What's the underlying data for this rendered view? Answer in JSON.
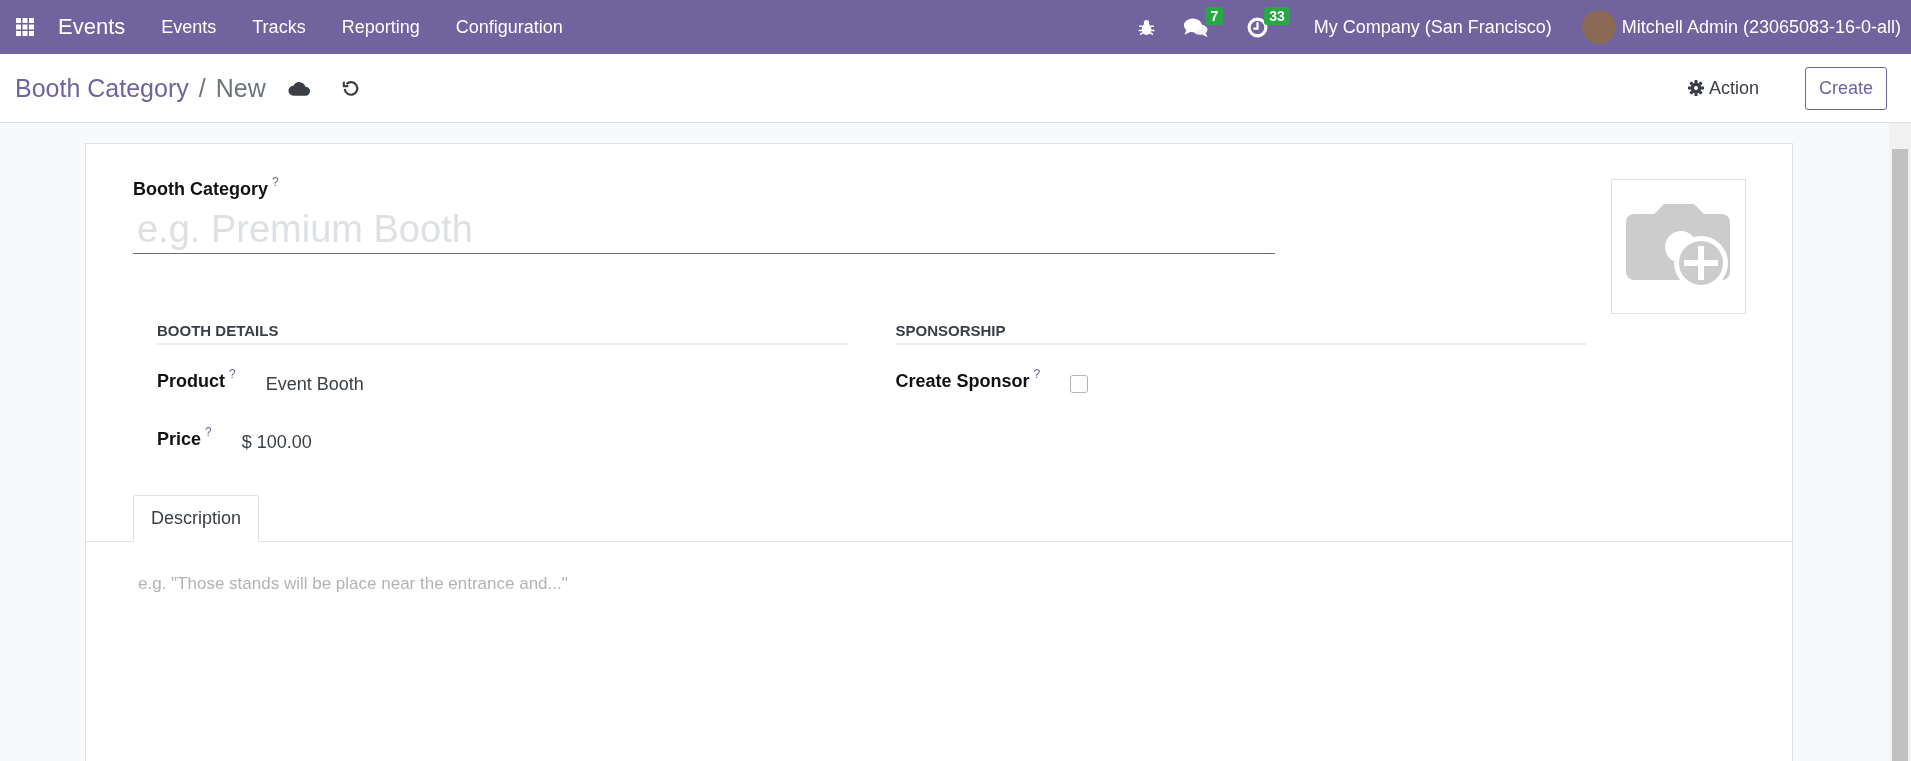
{
  "navbar": {
    "app_name": "Events",
    "menus": [
      "Events",
      "Tracks",
      "Reporting",
      "Configuration"
    ],
    "messages_badge": "7",
    "activities_badge": "33",
    "company": "My Company (San Francisco)",
    "user": "Mitchell Admin (23065083-16-0-all)"
  },
  "control_panel": {
    "breadcrumb_parent": "Booth Category",
    "breadcrumb_separator": "/",
    "breadcrumb_current": "New",
    "action_button": "Action",
    "create_button": "Create"
  },
  "form": {
    "name_label": "Booth Category",
    "name_help": "?",
    "name_placeholder": "e.g. Premium Booth",
    "groups": [
      {
        "title": "BOOTH DETAILS",
        "fields": [
          {
            "kind": "text",
            "label": "Product",
            "help": "?",
            "value": "Event Booth"
          },
          {
            "kind": "text",
            "label": "Price",
            "help": "?",
            "value": "$ 100.00"
          }
        ]
      },
      {
        "title": "SPONSORSHIP",
        "fields": [
          {
            "kind": "checkbox",
            "label": "Create Sponsor",
            "help": "?",
            "checked": false
          }
        ]
      }
    ],
    "tabs": [
      {
        "label": "Description",
        "selected": true
      }
    ],
    "description_placeholder": "e.g. \"Those stands will be place near the entrance and...\""
  }
}
